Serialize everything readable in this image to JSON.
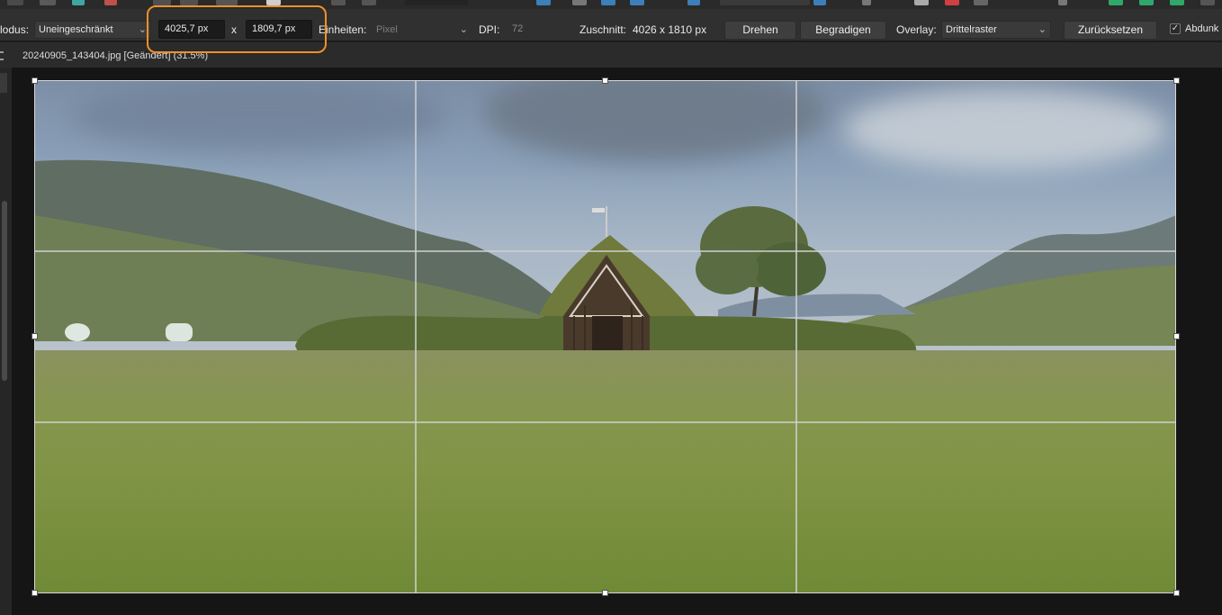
{
  "toolbar": {
    "mode_label": "lodus:",
    "mode_value": "Uneingeschränkt",
    "width_value": "4025,7 px",
    "times": "x",
    "height_value": "1809,7 px",
    "units_label": "Einheiten:",
    "units_value": "Pixel",
    "dpi_label": "DPI:",
    "dpi_value": "72",
    "crop_label": "Zuschnitt:",
    "crop_value": "4026 x 1810 px",
    "rotate_button": "Drehen",
    "straighten_button": "Begradigen",
    "overlay_label": "Overlay:",
    "overlay_value": "Drittelraster",
    "reset_button": "Zurücksetzen",
    "darken_label": "Abdunk",
    "darken_checked": "✓"
  },
  "document": {
    "title": "20240905_143404.jpg [Geändert] (31.5%)"
  },
  "colors": {
    "accent_highlight": "#f0902a",
    "toolbar_bg": "#303030",
    "canvas_bg": "#151515"
  },
  "icons": {
    "chevron": "chevron-down-icon",
    "check": "checkmark-icon"
  }
}
